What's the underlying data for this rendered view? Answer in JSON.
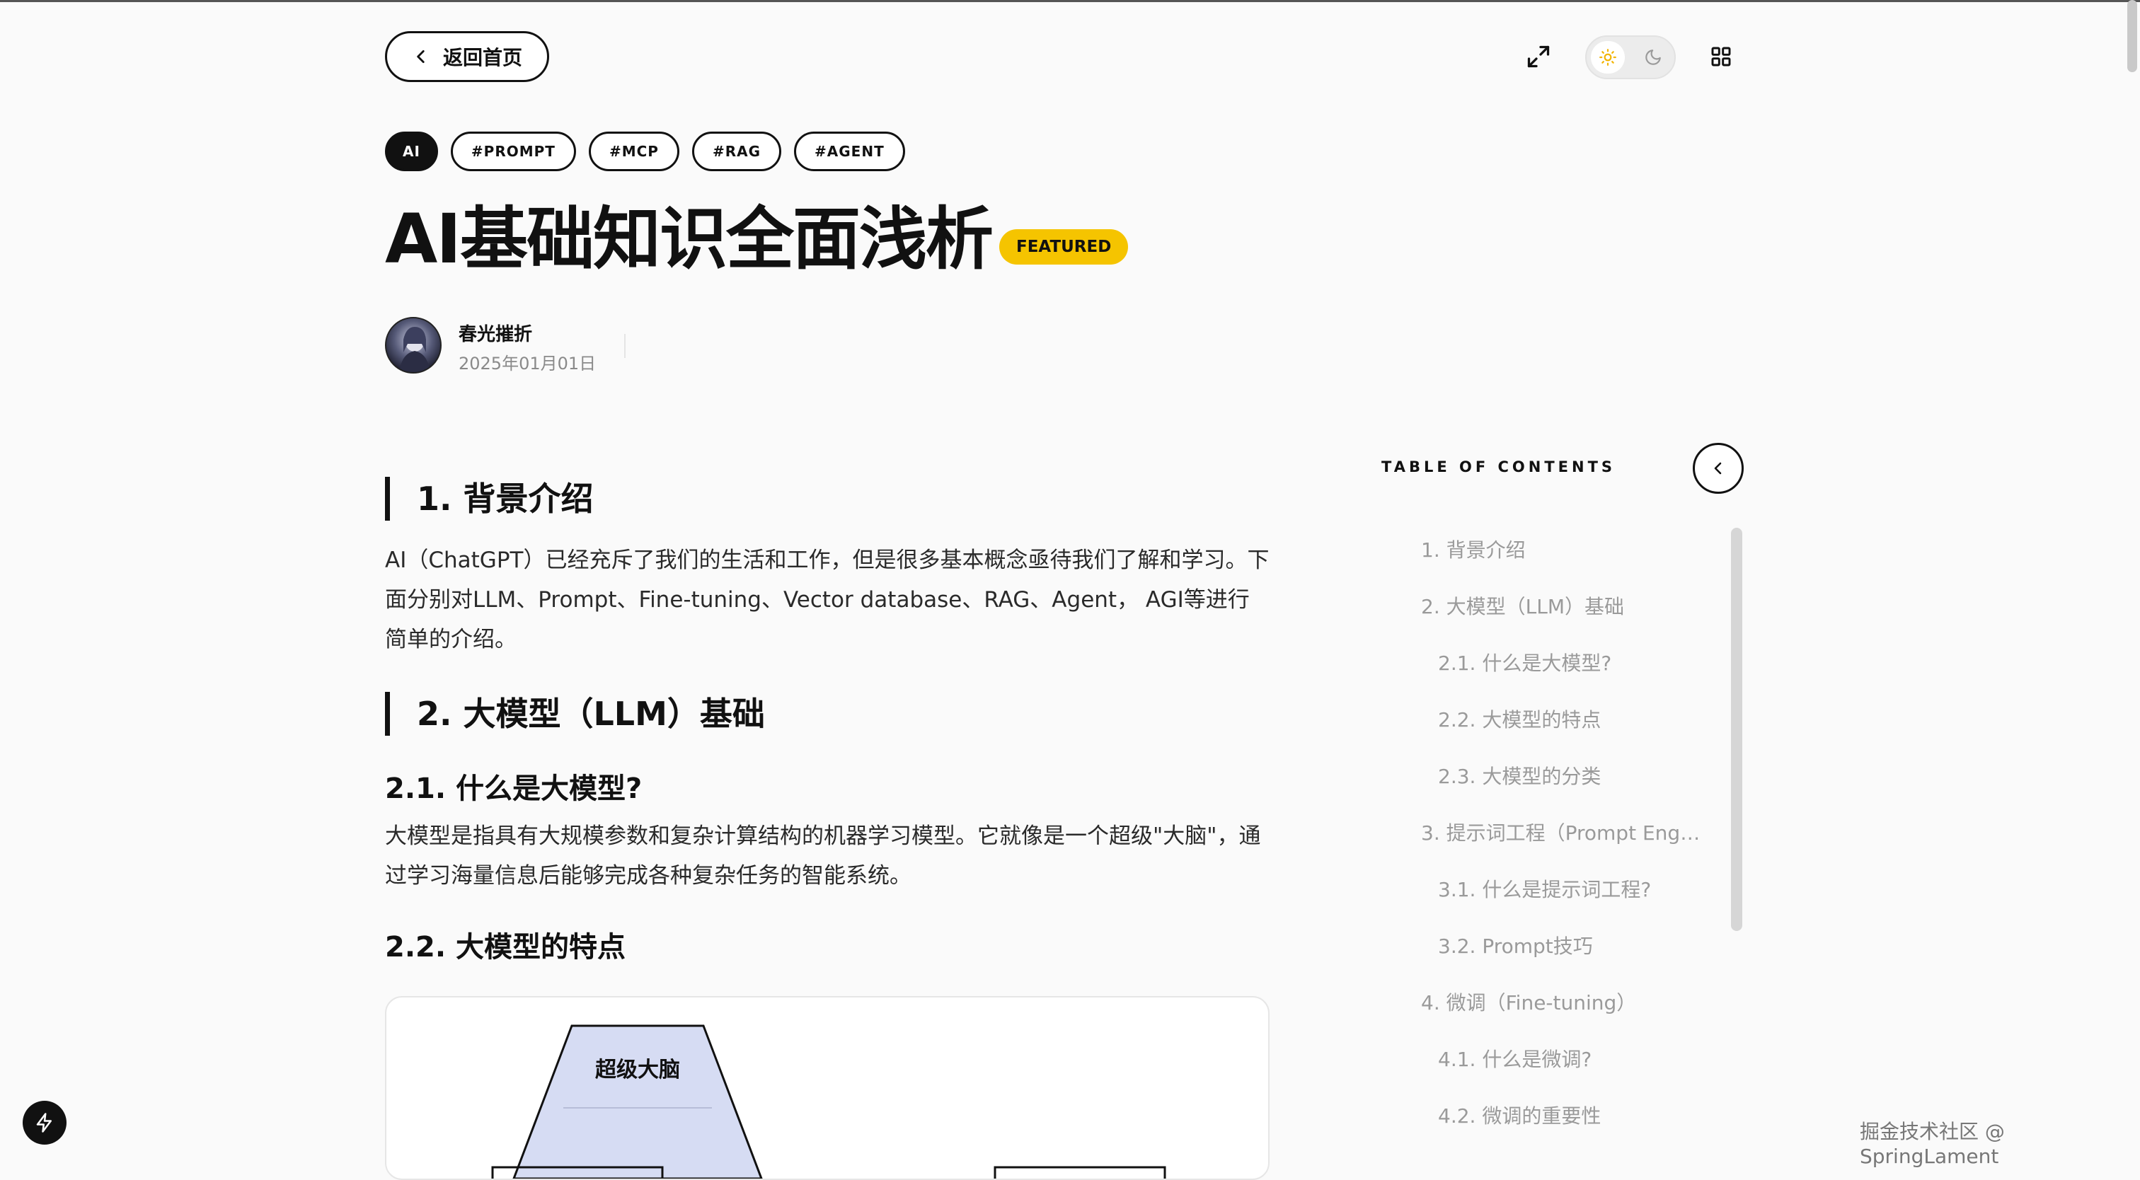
{
  "nav": {
    "back_label": "返回首页"
  },
  "tags": [
    "AI",
    "#PROMPT",
    "#MCP",
    "#RAG",
    "#AGENT"
  ],
  "article": {
    "title": "AI基础知识全面浅析",
    "featured_label": "FEATURED",
    "author": "春光摧折",
    "date": "2025年01月01日"
  },
  "content": {
    "h1": "1. 背景介绍",
    "p1": "AI（ChatGPT）已经充斥了我们的生活和工作，但是很多基本概念亟待我们了解和学习。下面分别对LLM、Prompt、Fine-tuning、Vector database、RAG、Agent， AGI等进行简单的介绍。",
    "h2": "2. 大模型（LLM）基础",
    "h2_1": "2.1. 什么是大模型?",
    "p2": "大模型是指具有大规模参数和复杂计算结构的机器学习模型。它就像是一个超级\"大脑\"，通过学习海量信息后能够完成各种复杂任务的智能系统。",
    "h2_2": "2.2. 大模型的特点",
    "figure_label": "超级大脑"
  },
  "toc": {
    "title": "TABLE OF CONTENTS",
    "items": [
      {
        "label": "1. 背景介绍",
        "level": 1
      },
      {
        "label": "2. 大模型（LLM）基础",
        "level": 1
      },
      {
        "label": "2.1. 什么是大模型?",
        "level": 2
      },
      {
        "label": "2.2. 大模型的特点",
        "level": 2
      },
      {
        "label": "2.3. 大模型的分类",
        "level": 2
      },
      {
        "label": "3. 提示词工程（Prompt Engi...",
        "level": 1
      },
      {
        "label": "3.1. 什么是提示词工程?",
        "level": 2
      },
      {
        "label": "3.2. Prompt技巧",
        "level": 2
      },
      {
        "label": "4. 微调（Fine-tuning）",
        "level": 1
      },
      {
        "label": "4.1. 什么是微调?",
        "level": 2
      },
      {
        "label": "4.2. 微调的重要性",
        "level": 2
      }
    ]
  },
  "watermark": "掘金技术社区 @ SpringLament",
  "colors": {
    "featured": "#f5c400",
    "sun": "#f2b400",
    "figure_fill": "#d6dcf3"
  }
}
